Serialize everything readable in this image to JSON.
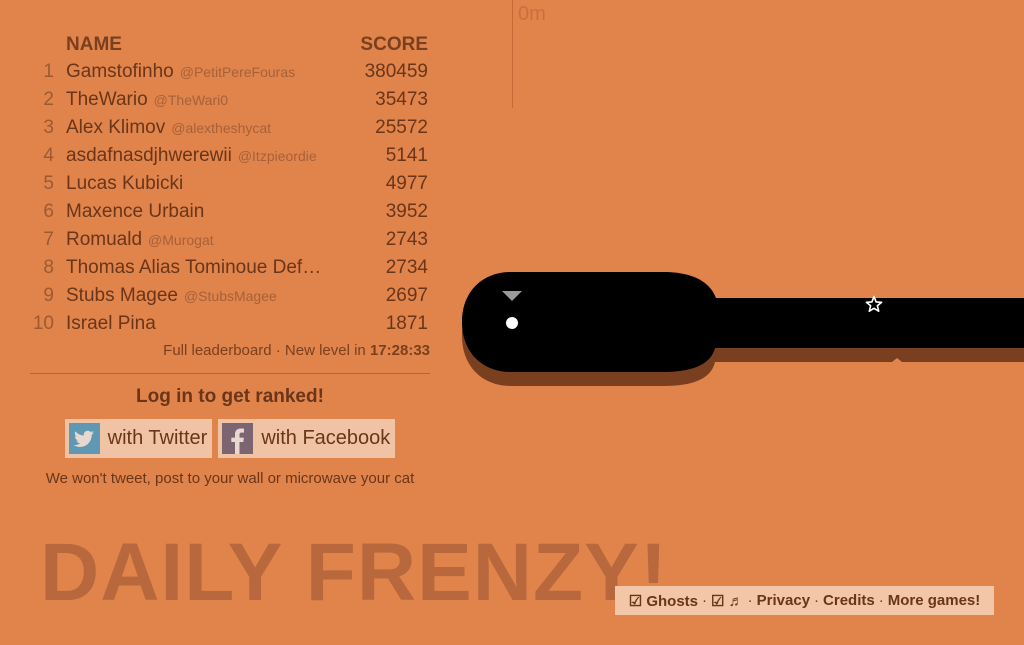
{
  "game": {
    "distance": "0m",
    "title": "DAILY FRENZY!"
  },
  "leaderboard": {
    "name_header": "NAME",
    "score_header": "SCORE",
    "entries": [
      {
        "rank": "1",
        "name": "Gamstofinho",
        "handle": "@PetitPereFouras",
        "score": "380459"
      },
      {
        "rank": "2",
        "name": "TheWario",
        "handle": "@TheWari0",
        "score": "35473"
      },
      {
        "rank": "3",
        "name": "Alex Klimov",
        "handle": "@alextheshycat",
        "score": "25572"
      },
      {
        "rank": "4",
        "name": "asdafnasdjhwerewii",
        "handle": "@Itzpieordie",
        "score": "5141"
      },
      {
        "rank": "5",
        "name": "Lucas Kubicki",
        "handle": "",
        "score": "4977"
      },
      {
        "rank": "6",
        "name": "Maxence Urbain",
        "handle": "",
        "score": "3952"
      },
      {
        "rank": "7",
        "name": "Romuald",
        "handle": "@Murogat",
        "score": "2743"
      },
      {
        "rank": "8",
        "name": "Thomas Alias Tominoue Def…",
        "handle": "",
        "score": "2734"
      },
      {
        "rank": "9",
        "name": "Stubs Magee",
        "handle": "@StubsMagee",
        "score": "2697"
      },
      {
        "rank": "10",
        "name": "Israel Pina",
        "handle": "",
        "score": "1871"
      }
    ],
    "full_leaderboard_label": "Full leaderboard",
    "separator": "·",
    "new_level_label": "New level in",
    "timer": "17:28:33"
  },
  "login": {
    "title": "Log in to get ranked!",
    "twitter_label": "with Twitter",
    "twitter_icon": "twitter-icon",
    "facebook_label": "with Facebook",
    "facebook_icon": "facebook-icon",
    "disclaimer": "We won't tweet, post to your wall or microwave your cat"
  },
  "footer": {
    "ghosts": "☑ Ghosts",
    "music": "☑ ♬",
    "privacy": "Privacy",
    "credits": "Credits",
    "more_games": "More games!",
    "sep": "·"
  },
  "colors": {
    "background": "#e0844c",
    "track": "#000000",
    "track_shadow": "#7a3f1f",
    "text": "#6a3519",
    "panel": "#f2c6a6"
  }
}
